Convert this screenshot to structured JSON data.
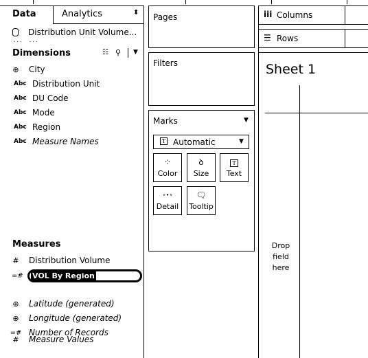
{
  "tabs": {
    "data": "Data",
    "analytics": "Analytics",
    "analytics_arrow": "⬍"
  },
  "datasource": {
    "name": "Distribution Unit Volume...",
    "icon": "database-icon"
  },
  "dimensions": {
    "title": "Dimensions",
    "items": [
      {
        "icon": "globe",
        "label": "City"
      },
      {
        "icon": "Abc",
        "label": "Distribution Unit"
      },
      {
        "icon": "Abc",
        "label": "DU Code"
      },
      {
        "icon": "Abc",
        "label": "Mode"
      },
      {
        "icon": "Abc",
        "label": "Region"
      },
      {
        "icon": "Abc",
        "label": "Measure Names"
      }
    ]
  },
  "measures": {
    "title": "Measures",
    "items": [
      {
        "icon": "#",
        "label": "Distribution Volume"
      },
      {
        "icon": "=#",
        "label": "VOL By Region"
      },
      {
        "icon": "globe",
        "label": "Latitude (generated)"
      },
      {
        "icon": "globe",
        "label": "Longitude (generated)"
      },
      {
        "icon": "=#",
        "label": "Number of Records"
      },
      {
        "icon": "#",
        "label": "Measure Values"
      }
    ]
  },
  "cards": {
    "pages": "Pages",
    "filters": "Filters",
    "marks": "Marks"
  },
  "marks": {
    "type": "Automatic",
    "buttons": {
      "color": "Color",
      "size": "Size",
      "text": "Text",
      "detail": "Detail",
      "tooltip": "Tooltip"
    }
  },
  "shelves": {
    "columns": "Columns",
    "rows": "Rows"
  },
  "sheet": {
    "title": "Sheet 1",
    "drop1": "Drop",
    "drop2": "field",
    "drop3": "here"
  },
  "colors": {
    "foreground": "#000000",
    "background": "#ffffff"
  }
}
